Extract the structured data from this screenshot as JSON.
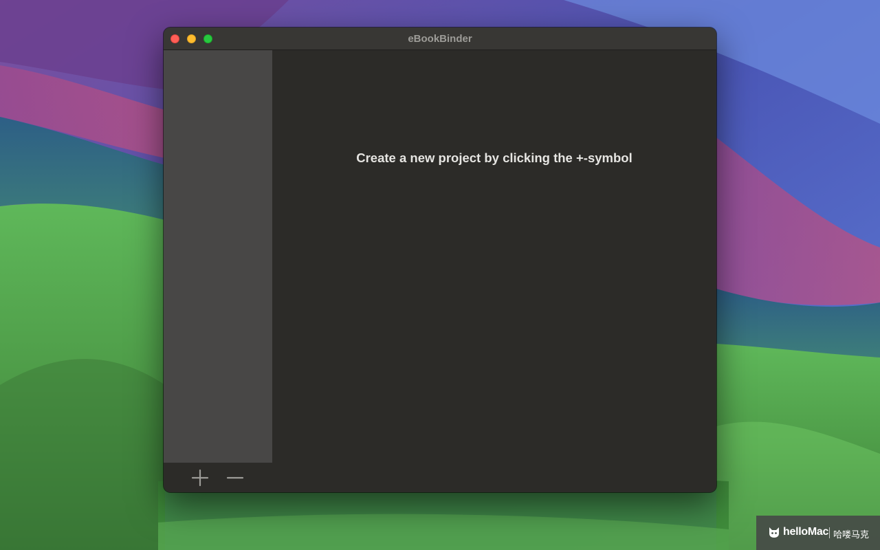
{
  "window": {
    "title": "eBookBinder"
  },
  "content": {
    "empty_message": "Create a new project by clicking the +-symbol"
  },
  "toolbar": {
    "add_icon": "plus-icon",
    "remove_icon": "minus-icon"
  },
  "watermark": {
    "brand": "helloMac",
    "brand_cn": "哈喽马克"
  },
  "colors": {
    "close": "#ff5f57",
    "minimize": "#febc2e",
    "zoom": "#28c840",
    "sidebar": "#484746",
    "content": "#2c2b28"
  }
}
